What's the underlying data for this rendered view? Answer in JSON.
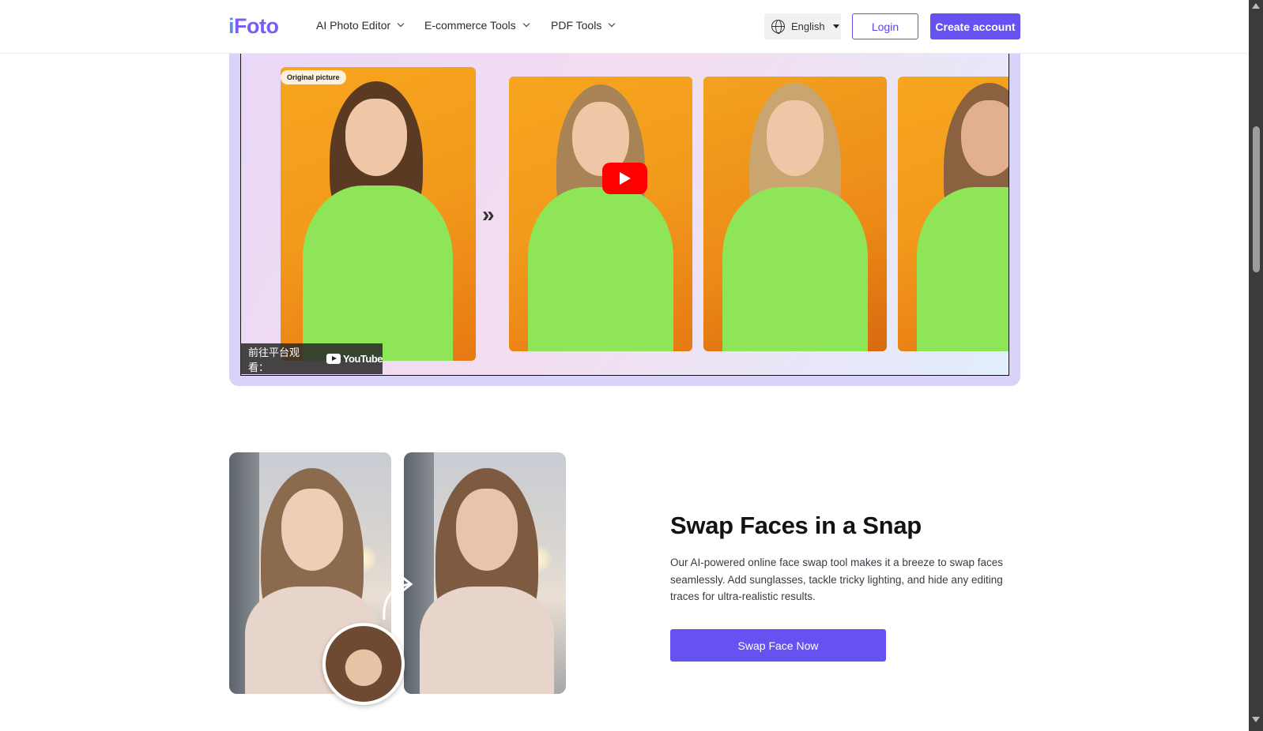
{
  "header": {
    "logo_prefix": "i",
    "logo_rest": "Foto",
    "nav": [
      {
        "label": "AI Photo Editor"
      },
      {
        "label": "E-commerce Tools"
      },
      {
        "label": "PDF Tools"
      }
    ],
    "language": "English",
    "login_label": "Login",
    "create_label": "Create account"
  },
  "video": {
    "badge": "Original picture",
    "watch_on_label": "前往平台观看：",
    "platform": "YouTube"
  },
  "feature": {
    "title": "Swap Faces in a Snap",
    "description": "Our AI-powered online face swap tool makes it a breeze to swap faces seamlessly. Add sunglasses, tackle tricky lighting, and hide any editing traces for ultra-realistic results.",
    "button_label": "Swap Face Now"
  },
  "colors": {
    "brand": "#6552f0",
    "youtube_red": "#ff0000",
    "photo_orange": "#f29a1c",
    "sweater_green": "#8ee557"
  },
  "icons": [
    "globe-icon",
    "chevron-down-icon",
    "caret-down-icon",
    "double-chevron-right-icon",
    "play-icon",
    "youtube-logo-icon",
    "curved-arrow-icon"
  ]
}
